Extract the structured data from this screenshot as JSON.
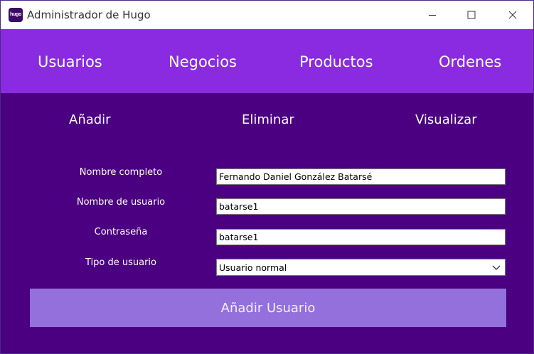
{
  "window": {
    "title": "Administrador de Hugo",
    "icon_text": "hugo"
  },
  "topnav": {
    "items": [
      {
        "label": "Usuarios"
      },
      {
        "label": "Negocios"
      },
      {
        "label": "Productos"
      },
      {
        "label": "Ordenes"
      }
    ]
  },
  "subnav": {
    "items": [
      {
        "label": "Añadir"
      },
      {
        "label": "Eliminar"
      },
      {
        "label": "Visualizar"
      }
    ]
  },
  "form": {
    "full_name": {
      "label": "Nombre completo",
      "value": "Fernando Daniel González Batarsé"
    },
    "username": {
      "label": "Nombre de usuario",
      "value": "batarse1"
    },
    "password": {
      "label": "Contraseña",
      "value": "batarse1"
    },
    "user_type": {
      "label": "Tipo de usuario",
      "value": "Usuario normal"
    },
    "submit_label": "Añadir Usuario"
  },
  "colors": {
    "topnav_bg": "#8a2be2",
    "body_bg": "#4b0082",
    "button_bg": "#9370db"
  }
}
